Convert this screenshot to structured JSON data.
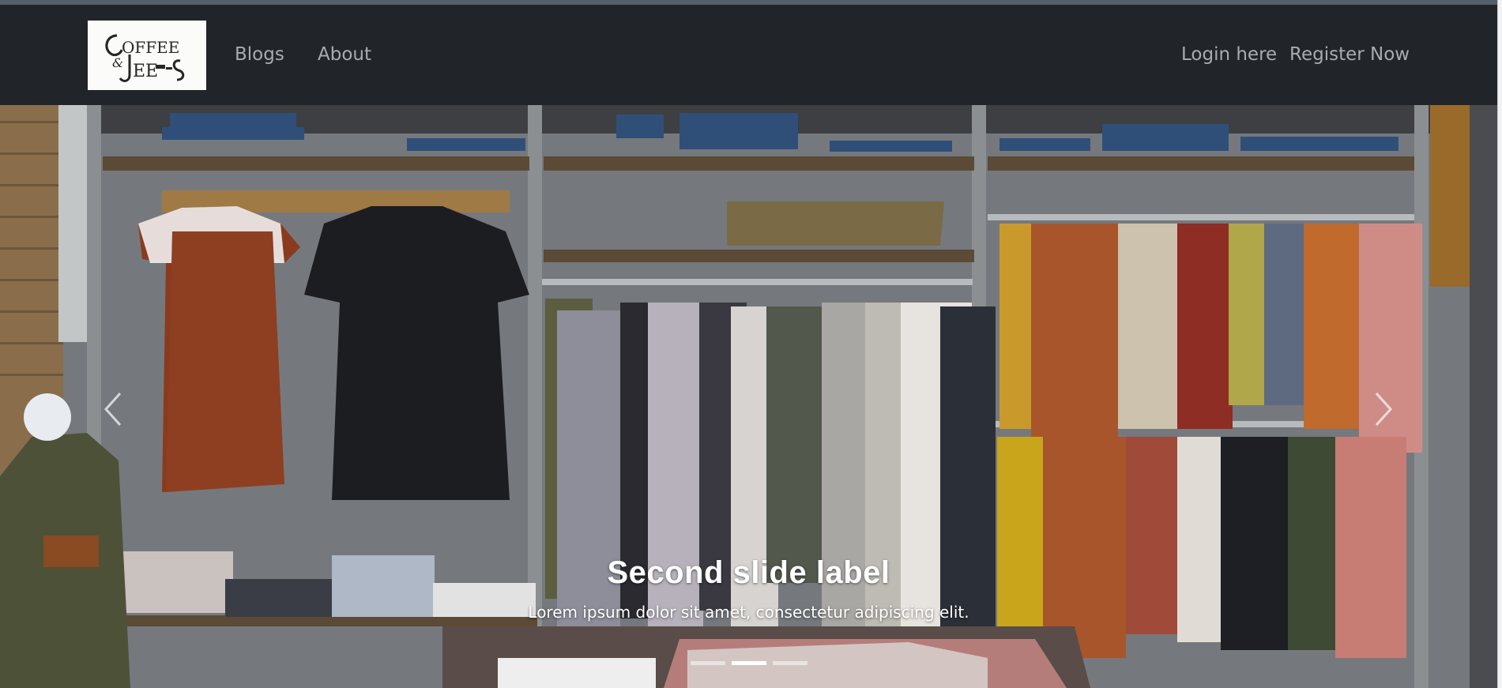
{
  "navbar": {
    "brand_alt": "Coffee & Jeans logo",
    "links": [
      {
        "label": "Blogs"
      },
      {
        "label": "About"
      }
    ],
    "auth": {
      "login_label": "Login here",
      "register_label": "Register Now"
    }
  },
  "carousel": {
    "caption_title": "Second slide label",
    "caption_text": "Lorem ipsum dolor sit amet, consectetur adipiscing elit.",
    "active_slide": 2,
    "slide_count": 3,
    "prev_icon": "chevron-left-icon",
    "next_icon": "chevron-right-icon"
  },
  "colors": {
    "navbar_bg": "#21252a",
    "nav_link": "#a8acb0",
    "caption_text": "#ffffff"
  }
}
